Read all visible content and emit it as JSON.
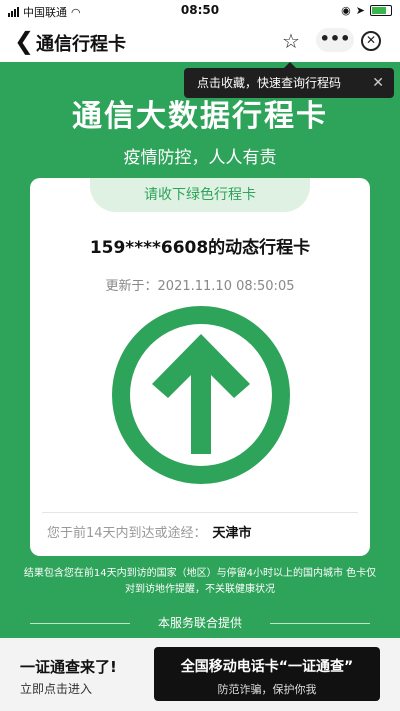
{
  "status_bar": {
    "carrier": "中国联通",
    "time": "08:50"
  },
  "nav": {
    "title": "通信行程卡",
    "more_label": "•••"
  },
  "tooltip": {
    "text": "点击收藏，快速查询行程码",
    "close": "✕"
  },
  "header": {
    "title": "通信大数据行程卡",
    "subtitle": "疫情防控，人人有责"
  },
  "card": {
    "tab_label": "请收下绿色行程卡",
    "phone": "159****6608的动态行程卡",
    "updated_label": "更新于：",
    "updated_time": "2021.11.10 08:50:05",
    "route_label": "您于前14天内到达或途经：",
    "route_city": "天津市",
    "arrow_color": "#2ea35a"
  },
  "note": "结果包含您在前14天内到访的国家（地区）与停留4小时以上的国内城市 色卡仅对到访地作提醒，不关联健康状况",
  "provided_by": "本服务联合提供",
  "promo": {
    "title": "一证通查来了!",
    "subtitle": "立即点击进入",
    "button_title": "全国移动电话卡“一证通查”",
    "button_sub": "防范诈骗，保护你我"
  },
  "colors": {
    "accent": "#2ea35a",
    "dark": "#111111"
  }
}
